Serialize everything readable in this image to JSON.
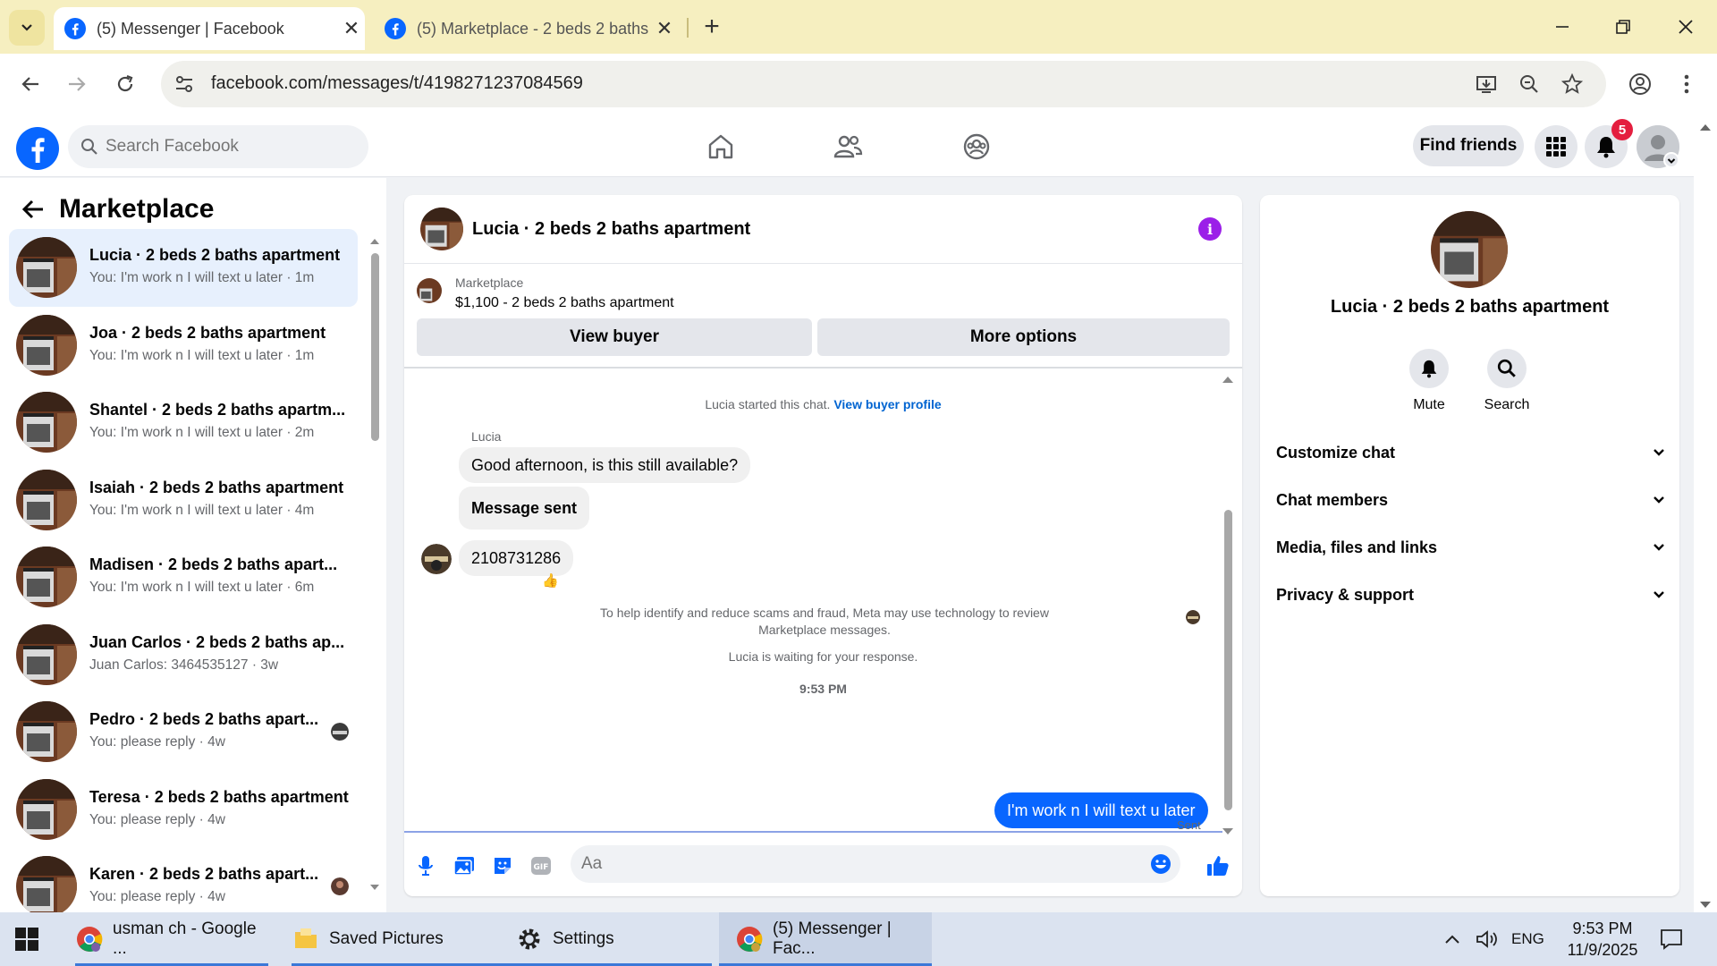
{
  "browser": {
    "tabs": [
      {
        "title": "(5) Messenger | Facebook",
        "active": true
      },
      {
        "title": "(5) Marketplace - 2 beds 2 baths",
        "active": false
      }
    ],
    "url": "facebook.com/messages/t/4198271237084569"
  },
  "fb_header": {
    "search_placeholder": "Search Facebook",
    "find_friends": "Find friends",
    "notification_count": "5",
    "brand_color": "#0866ff"
  },
  "sidebar": {
    "title": "Marketplace",
    "conversations": [
      {
        "name": "Lucia · 2 beds 2 baths apartment",
        "preview": "You: I'm work n I will text u later · 1m",
        "selected": true
      },
      {
        "name": "Joa · 2 beds 2 baths apartment",
        "preview": "You: I'm work n I will text u later · 1m"
      },
      {
        "name": "Shantel · 2 beds 2 baths apartm...",
        "preview": "You: I'm work n I will text u later · 2m"
      },
      {
        "name": "Isaiah · 2 beds 2 baths apartment",
        "preview": "You: I'm work n I will text u later · 4m"
      },
      {
        "name": "Madisen · 2 beds 2 baths apart...",
        "preview": "You: I'm work n I will text u later · 6m"
      },
      {
        "name": "Juan Carlos · 2 beds 2 baths ap...",
        "preview": "Juan Carlos: 3464535127 · 3w"
      },
      {
        "name": "Pedro · 2 beds 2 baths apart...",
        "preview": "You: please reply · 4w"
      },
      {
        "name": "Teresa · 2 beds 2 baths apartment",
        "preview": "You: please reply · 4w"
      },
      {
        "name": "Karen · 2 beds 2 baths apart...",
        "preview": "You: please reply · 4w"
      }
    ]
  },
  "chat": {
    "title": "Lucia · 2 beds 2 baths apartment",
    "listing_source": "Marketplace",
    "listing_price": "$1,100 - 2 beds 2 baths apartment",
    "view_buyer": "View buyer",
    "more_options": "More options",
    "started_text": "Lucia started this chat.",
    "buyer_profile_link": "View buyer profile",
    "sender_name": "Lucia",
    "messages": [
      {
        "text": "Good afternoon, is this still available?"
      },
      {
        "text": "Message sent"
      },
      {
        "text": "2108731286"
      }
    ],
    "reaction": "👍",
    "notice_line1": "To help identify and reduce scams and fraud, Meta may use technology to review",
    "notice_line2": "Marketplace messages.",
    "waiting": "Lucia is waiting for your response.",
    "timestamp": "9:53 PM",
    "outgoing": "I'm work n I will text u later",
    "sent_status": "Sent",
    "composer_placeholder": "Aa"
  },
  "info_panel": {
    "title": "Lucia · 2 beds 2 baths apartment",
    "mute": "Mute",
    "search": "Search",
    "sections": [
      "Customize chat",
      "Chat members",
      "Media, files and links",
      "Privacy & support"
    ]
  },
  "taskbar": {
    "items": [
      {
        "label": "usman ch - Google ..."
      },
      {
        "label": "Saved Pictures"
      },
      {
        "label": "Settings"
      },
      {
        "label": "(5) Messenger | Fac..."
      }
    ],
    "language": "ENG",
    "time": "9:53 PM",
    "date": "11/9/2025"
  }
}
